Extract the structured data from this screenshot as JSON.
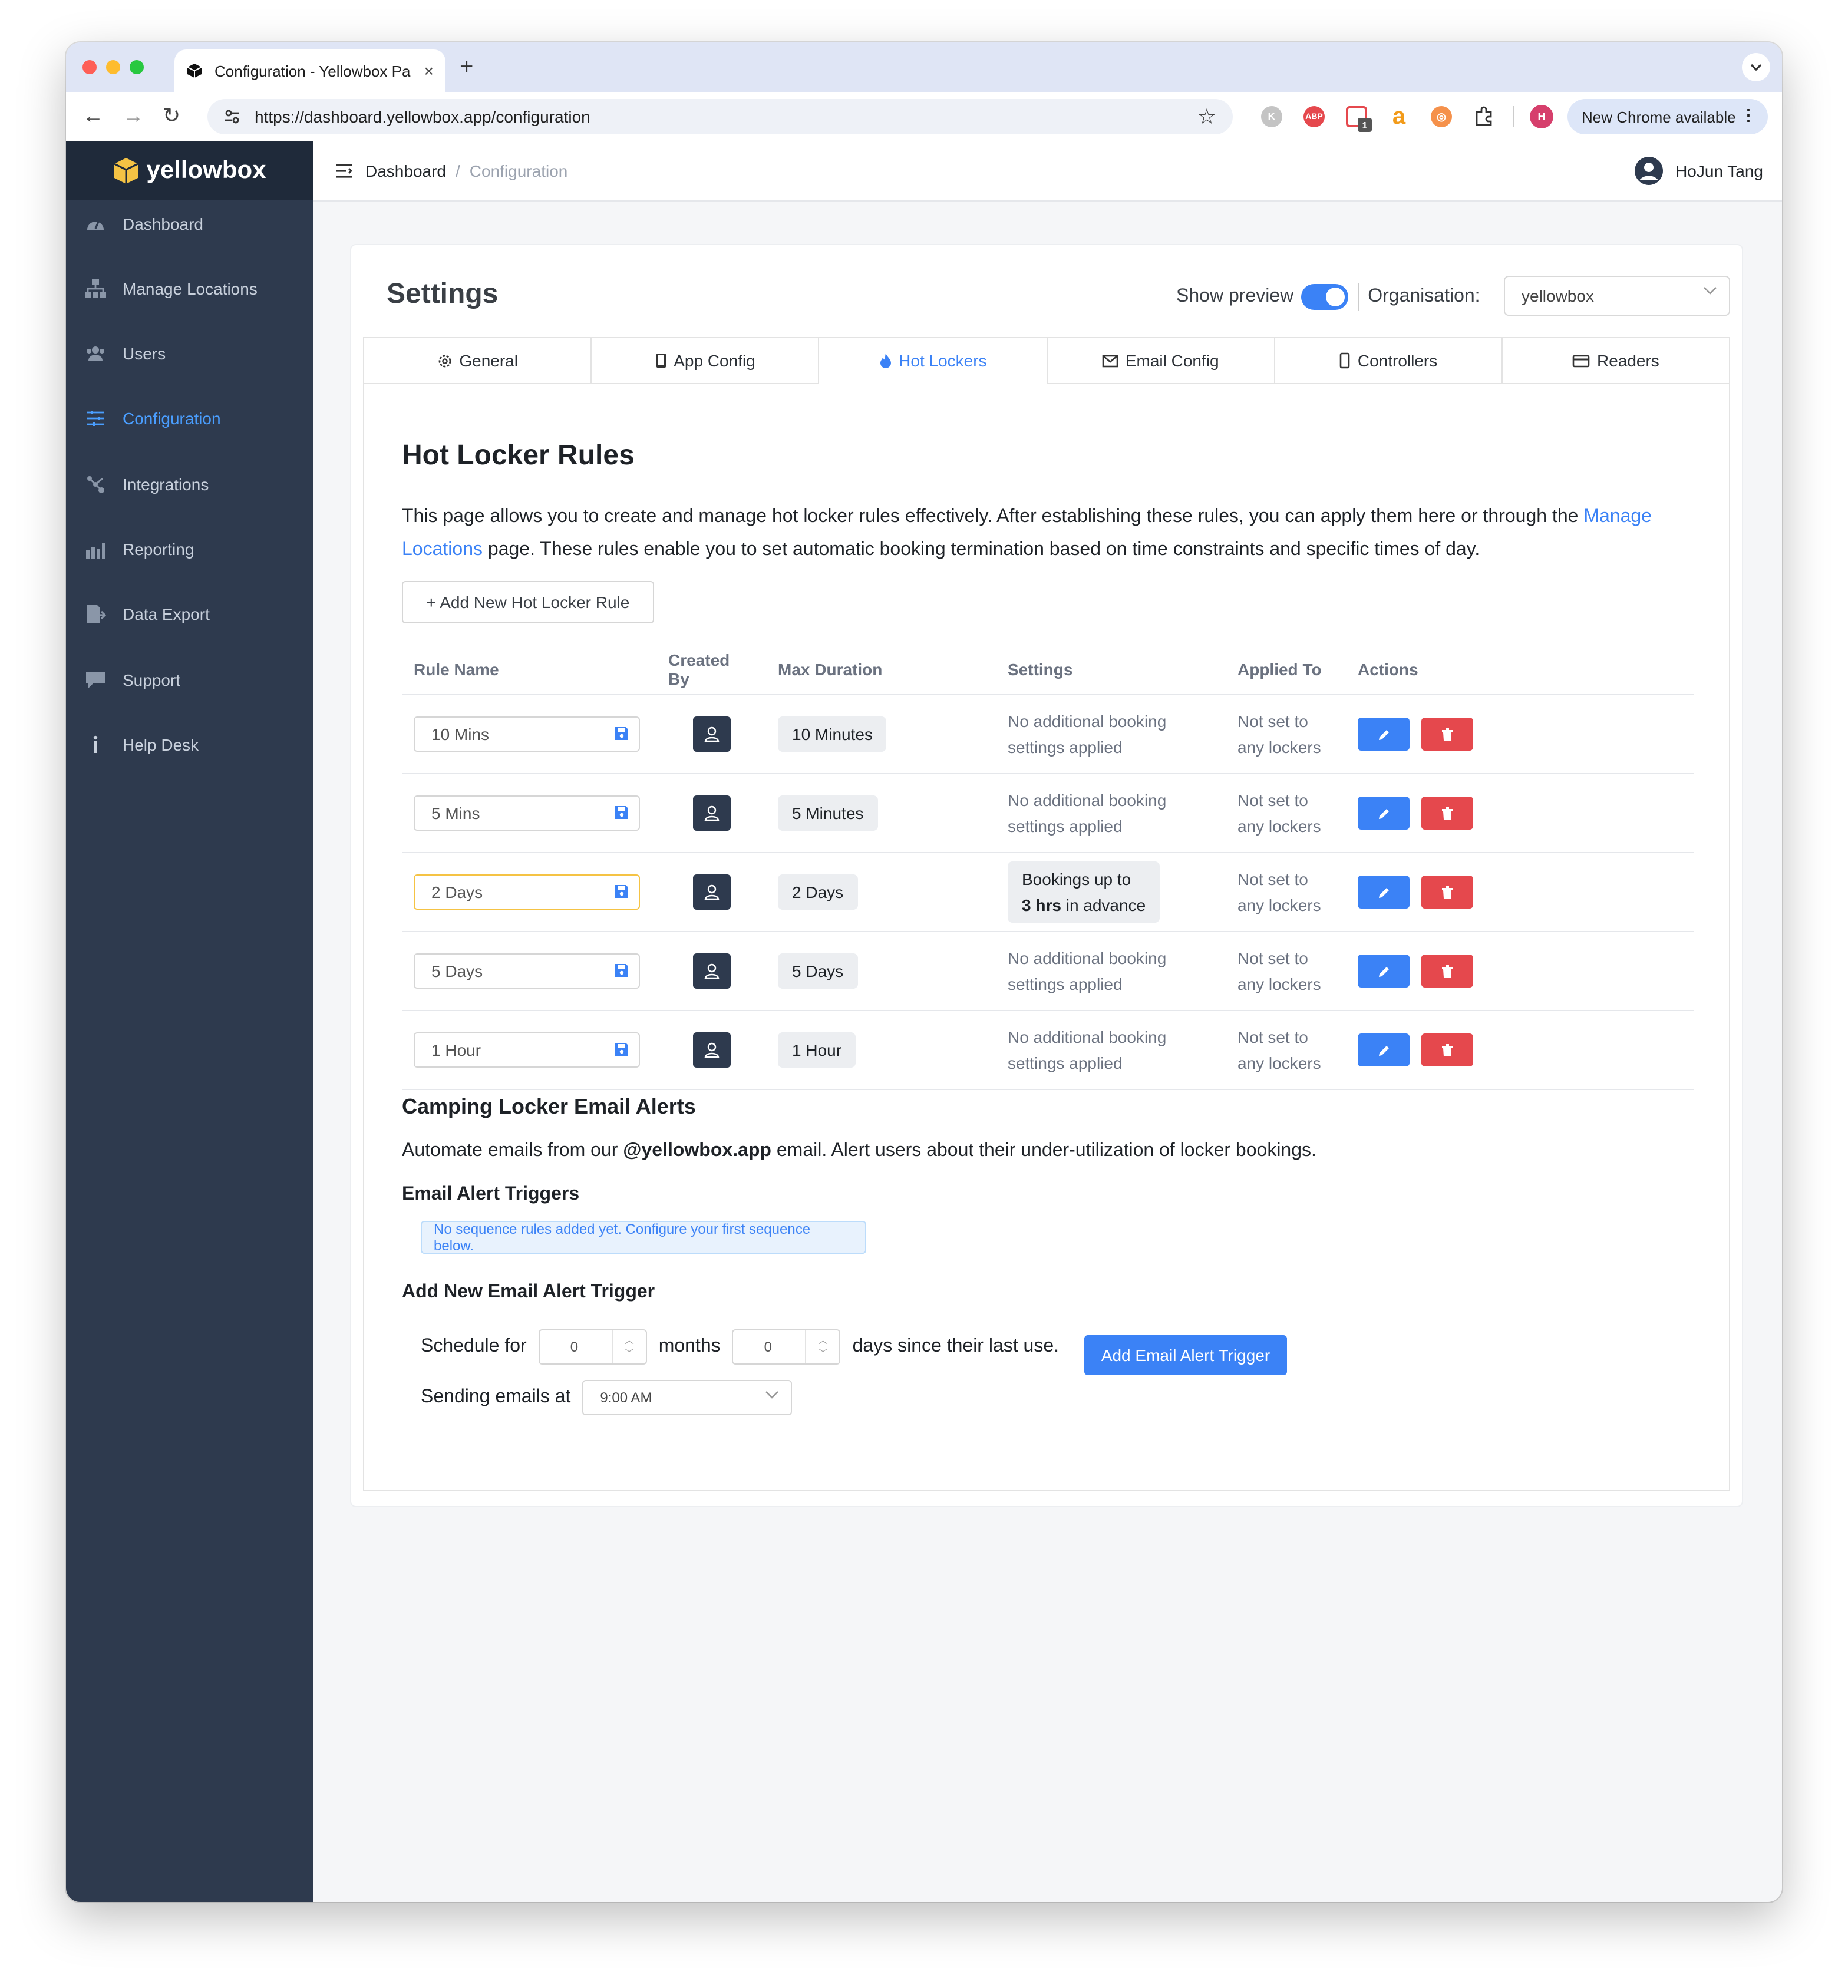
{
  "browser": {
    "tab_title": "Configuration - Yellowbox Pa",
    "tab_close": "×",
    "new_tab": "+",
    "url": "https://dashboard.yellowbox.app/configuration",
    "chrome_update": "New Chrome available",
    "profile_initial": "H",
    "ext_badge": "1",
    "abp_label": "ABP",
    "amazon_label": "a"
  },
  "app": {
    "brand": "yellowbox",
    "colors": {
      "accent": "#3b82f6",
      "sidebar": "#2e3a4e",
      "danger": "#e5484d",
      "logo": "#f5c344"
    }
  },
  "sidebar": {
    "items": [
      {
        "label": "Dashboard",
        "icon": "gauge-icon"
      },
      {
        "label": "Manage Locations",
        "icon": "sitemap-icon"
      },
      {
        "label": "Users",
        "icon": "users-icon"
      },
      {
        "label": "Configuration",
        "icon": "sliders-icon",
        "active": true
      },
      {
        "label": "Integrations",
        "icon": "nodes-icon"
      },
      {
        "label": "Reporting",
        "icon": "bar-chart-icon"
      },
      {
        "label": "Data Export",
        "icon": "file-export-icon"
      },
      {
        "label": "Support",
        "icon": "chat-icon"
      },
      {
        "label": "Help Desk",
        "icon": "info-icon"
      }
    ]
  },
  "breadcrumb": {
    "root": "Dashboard",
    "sep": "/",
    "current": "Configuration"
  },
  "user": {
    "name": "HoJun Tang"
  },
  "settings": {
    "title": "Settings",
    "show_preview_label": "Show preview",
    "show_preview_on": true,
    "org_label": "Organisation:",
    "org_value": "yellowbox",
    "tabs": [
      {
        "label": "General",
        "icon": "gear-icon"
      },
      {
        "label": "App Config",
        "icon": "phone-icon"
      },
      {
        "label": "Hot Lockers",
        "icon": "fire-icon",
        "active": true
      },
      {
        "label": "Email Config",
        "icon": "envelope-icon"
      },
      {
        "label": "Controllers",
        "icon": "device-icon"
      },
      {
        "label": "Readers",
        "icon": "card-icon"
      }
    ]
  },
  "hot_lockers": {
    "title": "Hot Locker Rules",
    "desc_1": "This page allows you to create and manage hot locker rules effectively. After establishing these rules, you can apply them here or through the",
    "desc_link": "Manage Locations",
    "desc_2": "page. These rules enable you to set automatic booking termination based on time constraints and specific times of day.",
    "add_button": "+ Add New Hot Locker Rule",
    "columns": [
      "Rule Name",
      "Created By",
      "Max Duration",
      "Settings",
      "Applied To",
      "Actions"
    ],
    "rows": [
      {
        "name": "10 Mins",
        "duration": "10 Minutes",
        "settings_1": "No additional booking",
        "settings_2": "settings applied",
        "applied_1": "Not set to",
        "applied_2": "any lockers"
      },
      {
        "name": "5 Mins",
        "duration": "5 Minutes",
        "settings_1": "No additional booking",
        "settings_2": "settings applied",
        "applied_1": "Not set to",
        "applied_2": "any lockers"
      },
      {
        "name": "2 Days",
        "duration": "2 Days",
        "settings_1": "Bookings up to",
        "settings_bold": "3 hrs",
        "settings_2": "in advance",
        "applied_1": "Not set to",
        "applied_2": "any lockers",
        "highlight": true
      },
      {
        "name": "5 Days",
        "duration": "5 Days",
        "settings_1": "No additional booking",
        "settings_2": "settings applied",
        "applied_1": "Not set to",
        "applied_2": "any lockers"
      },
      {
        "name": "1 Hour",
        "duration": "1 Hour",
        "settings_1": "No additional booking",
        "settings_2": "settings applied",
        "applied_1": "Not set to",
        "applied_2": "any lockers"
      }
    ]
  },
  "camping": {
    "title": "Camping Locker Email Alerts",
    "desc_pre": "Automate emails from our",
    "desc_bold": "@yellowbox.app",
    "desc_post": "email. Alert users about their under-utilization of locker bookings.",
    "triggers_title": "Email Alert Triggers",
    "empty_notice": "No sequence rules added yet. Configure your first sequence below.",
    "add_title": "Add New Email Alert Trigger",
    "schedule_label": "Schedule for",
    "months_value": "0",
    "months_label": "months",
    "days_value": "0",
    "days_label": "days since their last use.",
    "sending_label": "Sending emails at",
    "time_value": "9:00 AM",
    "add_button": "Add Email Alert Trigger"
  }
}
